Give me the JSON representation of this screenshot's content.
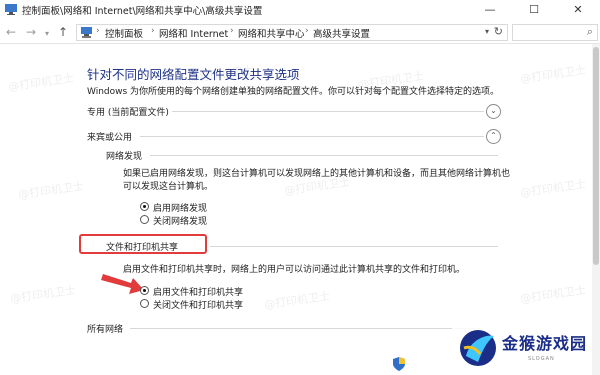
{
  "window": {
    "title": "控制面板\\网络和 Internet\\网络和共享中心\\高级共享设置",
    "min_glyph": "—",
    "max_glyph": "☐",
    "close_glyph": "✕"
  },
  "address": {
    "segments": [
      "控制面板",
      "网络和 Internet",
      "网络和共享中心",
      "高级共享设置"
    ],
    "separator": "›"
  },
  "page": {
    "title": "针对不同的网络配置文件更改共享选项",
    "description": "Windows 为你所使用的每个网络创建单独的网络配置文件。你可以针对每个配置文件选择特定的选项。"
  },
  "sections": {
    "private": {
      "label": "专用 (当前配置文件)",
      "state": "collapsed"
    },
    "guest": {
      "label": "来宾或公用",
      "state": "expanded"
    },
    "all": {
      "label": "所有网络",
      "state": "collapsed"
    }
  },
  "network_discovery": {
    "heading": "网络发现",
    "desc_line1": "如果已启用网络发现，则这台计算机可以发现网络上的其他计算机和设备，而且其他网络计算机也",
    "desc_line2": "可以发现这台计算机。",
    "options": [
      {
        "label": "启用网络发现",
        "selected": true
      },
      {
        "label": "关闭网络发现",
        "selected": false
      }
    ]
  },
  "file_printer_sharing": {
    "heading": "文件和打印机共享",
    "desc": "启用文件和打印机共享时，网络上的用户可以访问通过此计算机共享的文件和打印机。",
    "options": [
      {
        "label": "启用文件和打印机共享",
        "selected": true
      },
      {
        "label": "关闭文件和打印机共享",
        "selected": false
      }
    ]
  },
  "watermark": {
    "text": "@打印机卫士"
  },
  "logo": {
    "brand": "金猴游戏园",
    "slogan": "SLOGAN"
  },
  "colors": {
    "title_blue": "#1e3287",
    "highlight_red": "#e23b3b"
  },
  "icons": {
    "app": "control-panel-icon",
    "back": "arrow-left-icon",
    "forward": "arrow-right-icon",
    "up": "arrow-up-icon",
    "refresh": "refresh-icon",
    "search": "search-icon",
    "chevron_down": "chevron-down-icon",
    "chevron_up": "chevron-up-icon"
  }
}
